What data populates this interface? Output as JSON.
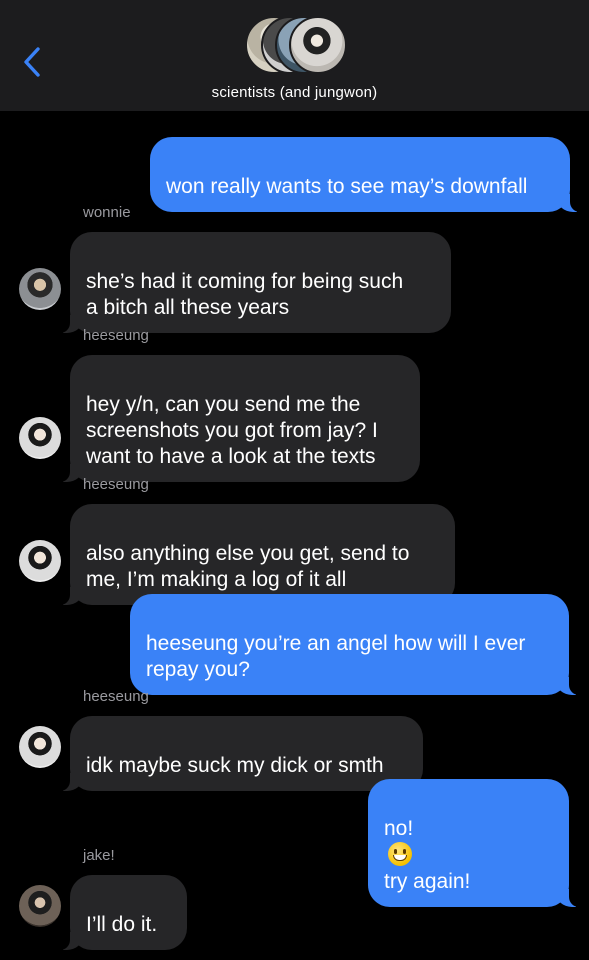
{
  "header": {
    "group_name": "scientists (and jungwon)"
  },
  "messages": [
    {
      "from": "me",
      "text": "won really wants to see may’s downfall"
    },
    {
      "sender": "wonnie",
      "text": "she’s had it coming for being such\na bitch all these years"
    },
    {
      "sender": "heeseung",
      "text": "hey y/n, can you send me the\nscreenshots you got from jay? I\nwant to have a look at the texts"
    },
    {
      "sender": "heeseung",
      "text": "also anything else you get, send to\nme, I’m making a log of it all"
    },
    {
      "from": "me",
      "text": "heeseung you’re an angel how will I ever\nrepay you?"
    },
    {
      "sender": "heeseung",
      "text": "idk maybe suck my dick or smth"
    },
    {
      "from": "me",
      "text_before": "no!",
      "emoji": "grinning-face",
      "text_after": "try again!"
    },
    {
      "sender": "jake!",
      "text": "I’ll do it."
    }
  ],
  "colors": {
    "header_bg": "#1c1c1e",
    "outgoing_bubble": "#3a82f7",
    "incoming_bubble": "#262628",
    "sender_label": "#9a9a9f",
    "back_accent": "#3a82f7"
  },
  "icons": {
    "back": "chevron-left-icon",
    "emoji": "grinning-face-emoji"
  }
}
